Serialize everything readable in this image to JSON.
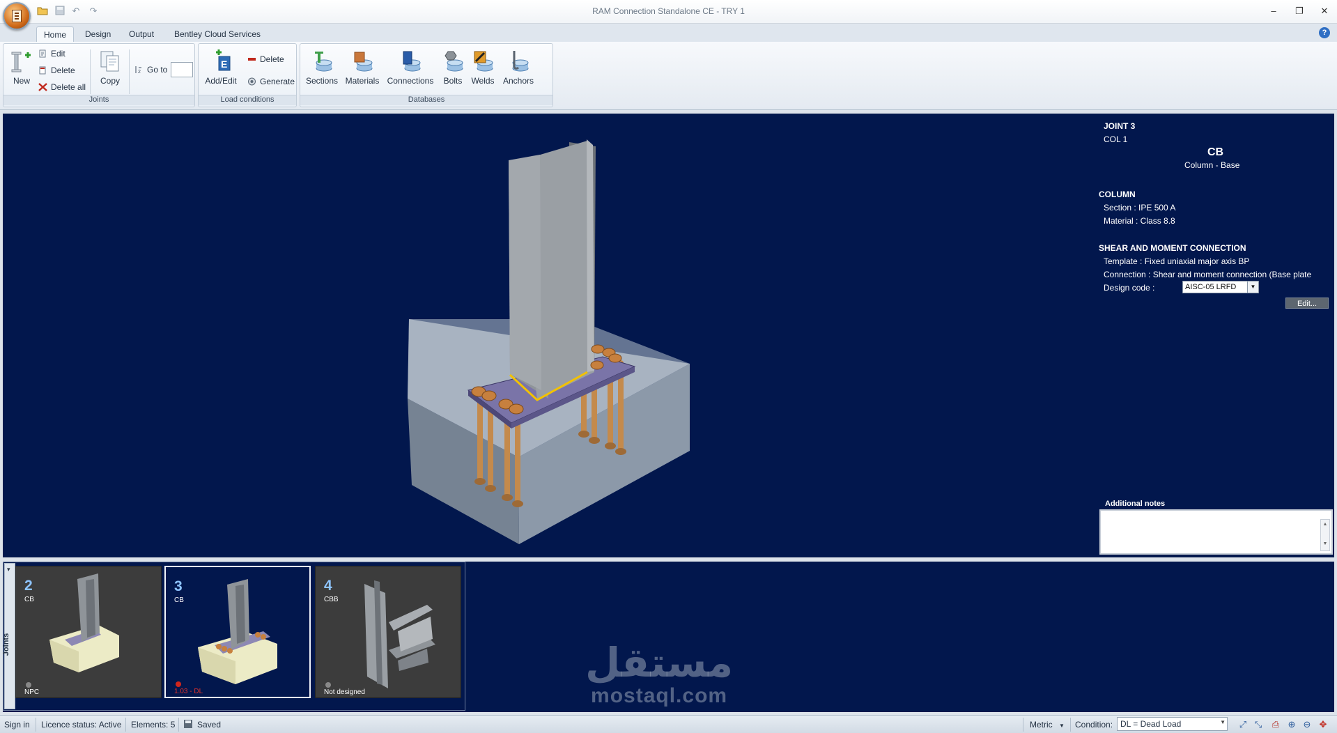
{
  "window": {
    "title": "RAM Connection Standalone CE - TRY 1",
    "minimize": "–",
    "restore": "❐",
    "close": "✕"
  },
  "quick_access": [
    "open",
    "save",
    "undo",
    "redo"
  ],
  "tabs": [
    {
      "label": "Home",
      "active": true
    },
    {
      "label": "Design",
      "active": false
    },
    {
      "label": "Output",
      "active": false
    },
    {
      "label": "Bentley Cloud Services",
      "active": false
    }
  ],
  "help_label": "?",
  "ribbon": {
    "joints": {
      "label": "Joints",
      "new": "New",
      "edit": "Edit",
      "delete": "Delete",
      "delete_all": "Delete all",
      "copy": "Copy",
      "goto": "Go to",
      "goto_value": ""
    },
    "load_conditions": {
      "label": "Load conditions",
      "add_edit": "Add/Edit",
      "delete": "Delete",
      "generate": "Generate"
    },
    "databases": {
      "label": "Databases",
      "sections": "Sections",
      "materials": "Materials",
      "connections": "Connections",
      "bolts": "Bolts",
      "welds": "Welds",
      "anchors": "Anchors"
    }
  },
  "joint_info": {
    "joint": "JOINT 3",
    "member": "COL 1",
    "code": "CB",
    "type": "Column - Base",
    "column_heading": "COLUMN",
    "section": "Section : IPE 500 A",
    "material": "Material : Class 8.8",
    "connection_heading": "SHEAR AND MOMENT CONNECTION",
    "template": "Template : Fixed uniaxial major axis BP",
    "connection": "Connection : Shear and moment connection (Base plate",
    "design_code_label": "Design code :",
    "design_code_value": "AISC-05 LRFD",
    "edit_button": "Edit...",
    "notes_label": "Additional notes",
    "notes_value": ""
  },
  "joints_panel": {
    "tab_label": "Joints",
    "items": [
      {
        "number": "2",
        "type": "CB",
        "status": "NPC",
        "status_color": "#ffffff"
      },
      {
        "number": "3",
        "type": "CB",
        "status": "1.03 - DL",
        "status_color": "#e0322a",
        "selected": true
      },
      {
        "number": "4",
        "type": "CBB",
        "status": "Not designed",
        "status_color": "#ffffff"
      }
    ]
  },
  "watermark": {
    "arabic": "مستقل",
    "latin": "mostaql.com"
  },
  "statusbar": {
    "sign_in": "Sign in",
    "licence": "Licence status: Active",
    "elements": "Elements: 5",
    "saved": "Saved",
    "units": "Metric",
    "condition_label": "Condition:",
    "condition_value": "DL = Dead Load"
  },
  "colors": {
    "viewport_bg": "#02174d",
    "steel": "#9a9a9a",
    "concrete": "#a9b6c2",
    "bolts": "#c07a3a",
    "weld": "#f0c000",
    "plate": "#6f6aa0"
  }
}
